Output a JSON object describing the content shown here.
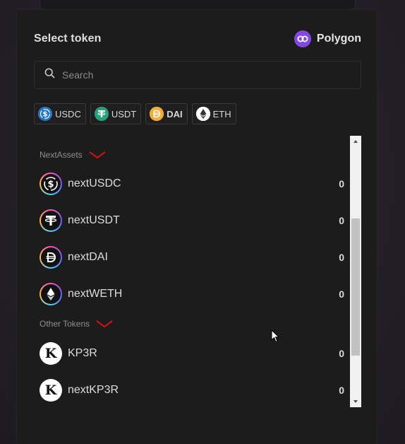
{
  "modal": {
    "title": "Select token",
    "network": {
      "name": "Polygon",
      "icon": "polygon-icon",
      "color": "#8247e5"
    }
  },
  "search": {
    "placeholder": "Search",
    "value": ""
  },
  "quick_tokens": [
    {
      "label": "USDC",
      "icon": "usdc-icon",
      "color": "#2775ca",
      "bold": false
    },
    {
      "label": "USDT",
      "icon": "usdt-icon",
      "color": "#26a17b",
      "bold": false
    },
    {
      "label": "DAI",
      "icon": "dai-icon",
      "color": "#f5ac37",
      "bold": true
    },
    {
      "label": "ETH",
      "icon": "eth-icon",
      "color": "#ffffff",
      "bold": false
    }
  ],
  "sections": [
    {
      "label": "NextAssets",
      "tokens": [
        {
          "name": "nextUSDC",
          "balance": "0",
          "icon": "usdc-icon"
        },
        {
          "name": "nextUSDT",
          "balance": "0",
          "icon": "usdt-icon"
        },
        {
          "name": "nextDAI",
          "balance": "0",
          "icon": "dai-icon"
        },
        {
          "name": "nextWETH",
          "balance": "0",
          "icon": "eth-icon"
        }
      ]
    },
    {
      "label": "Other Tokens",
      "tokens": [
        {
          "name": "KP3R",
          "balance": "0",
          "icon": "keep3r-icon"
        },
        {
          "name": "nextKP3R",
          "balance": "0",
          "icon": "keep3r-icon"
        }
      ]
    }
  ],
  "colors": {
    "modal_bg": "#1c1c1c",
    "annotation_red": "#e01010",
    "text_muted": "#8f8f8f"
  }
}
